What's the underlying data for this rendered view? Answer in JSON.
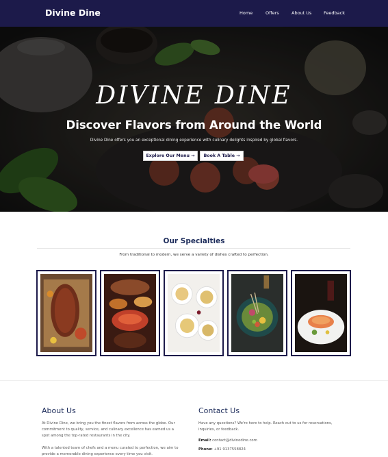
{
  "navbar": {
    "brand": "Divine Dine",
    "links": [
      "Home",
      "Offers",
      "About Us",
      "Feedback"
    ]
  },
  "hero": {
    "title": "DIVINE DINE",
    "subtitle": "Discover Flavors from Around the World",
    "description": "Divine Dine offers you an exceptional dining experience with culinary delights inspired by global flavors.",
    "buttons": [
      "Explore Our Menu →",
      "Book A Table →"
    ]
  },
  "specialties": {
    "title": "Our Specialties",
    "subtitle": "From traditional to modern, we serve a variety of dishes crafted to perfection.",
    "dishes": [
      "grilled-meat-platter",
      "mixed-dishes-table",
      "pasta-plates",
      "fresh-salad-bowl",
      "salmon-fine-dining"
    ]
  },
  "about": {
    "title": "About Us",
    "para1": "At Divine Dine, we bring you the finest flavors from across the globe. Our commitment to quality, service, and culinary excellence has earned us a spot among the top-rated restaurants in the city.",
    "para2": "With a talented team of chefs and a menu curated to perfection, we aim to provide a memorable dining experience every time you visit."
  },
  "contact": {
    "title": "Contact Us",
    "intro": "Have any questions? We're here to help. Reach out to us for reservations, inquiries, or feedback.",
    "email_label": "Email:",
    "email": "contact@divinedine.com",
    "phone_label": "Phone:",
    "phone": "+91 9137558824"
  },
  "colors": {
    "navy": "#1c1a4a",
    "heading": "#1c2b5a"
  }
}
